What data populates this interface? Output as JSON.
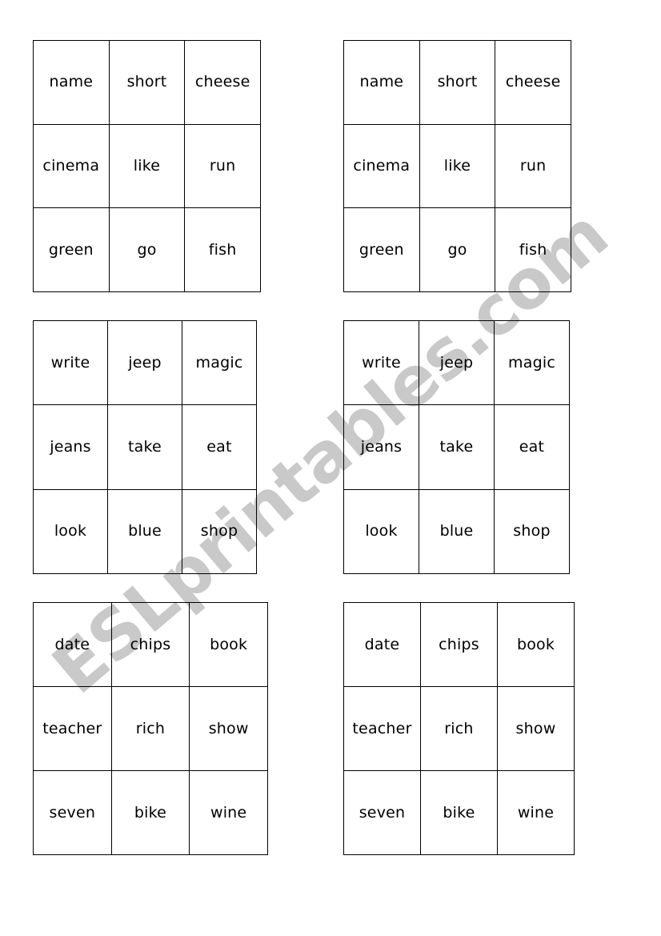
{
  "page": {
    "background_color": "#ffffff",
    "grid_line_color": "#000000",
    "text_color": "#000000"
  },
  "watermark": {
    "text": "ESLprintables.com",
    "color": "#c9c9c9",
    "rotation_degrees": -40
  },
  "cards": [
    {
      "id": "card-top-left",
      "rows": [
        [
          "name",
          "short",
          "cheese"
        ],
        [
          "cinema",
          "like",
          "run"
        ],
        [
          "green",
          "go",
          "fish"
        ]
      ]
    },
    {
      "id": "card-top-right",
      "rows": [
        [
          "name",
          "short",
          "cheese"
        ],
        [
          "cinema",
          "like",
          "run"
        ],
        [
          "green",
          "go",
          "fish"
        ]
      ]
    },
    {
      "id": "card-middle-left",
      "rows": [
        [
          "write",
          "jeep",
          "magic"
        ],
        [
          "jeans",
          "take",
          "eat"
        ],
        [
          "look",
          "blue",
          "shop"
        ]
      ]
    },
    {
      "id": "card-middle-right",
      "rows": [
        [
          "write",
          "jeep",
          "magic"
        ],
        [
          "jeans",
          "take",
          "eat"
        ],
        [
          "look",
          "blue",
          "shop"
        ]
      ]
    },
    {
      "id": "card-bottom-left",
      "rows": [
        [
          "date",
          "chips",
          "book"
        ],
        [
          "teacher",
          "rich",
          "show"
        ],
        [
          "seven",
          "bike",
          "wine"
        ]
      ]
    },
    {
      "id": "card-bottom-right",
      "rows": [
        [
          "date",
          "chips",
          "book"
        ],
        [
          "teacher",
          "rich",
          "show"
        ],
        [
          "seven",
          "bike",
          "wine"
        ]
      ]
    }
  ]
}
